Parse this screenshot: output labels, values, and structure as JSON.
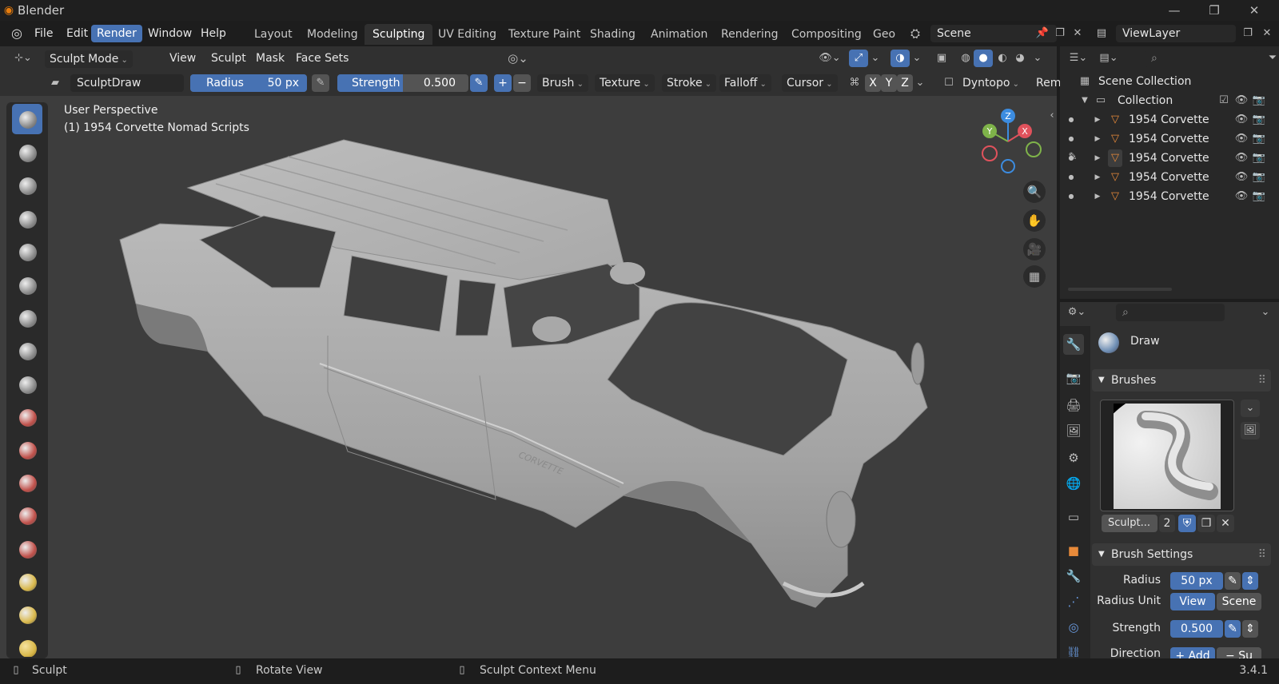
{
  "app": {
    "title": "Blender",
    "version": "3.4.1"
  },
  "menu": {
    "items": [
      "File",
      "Edit",
      "Render",
      "Window",
      "Help"
    ],
    "active": "Render"
  },
  "workspaces": {
    "tabs": [
      "Layout",
      "Modeling",
      "Sculpting",
      "UV Editing",
      "Texture Paint",
      "Shading",
      "Animation",
      "Rendering",
      "Compositing",
      "Geo"
    ],
    "active": "Sculpting"
  },
  "scene": {
    "name": "Scene",
    "view_layer": "ViewLayer"
  },
  "viewport_header": {
    "mode": "Sculpt Mode",
    "menus": [
      "View",
      "Sculpt",
      "Mask",
      "Face Sets"
    ]
  },
  "tool_header": {
    "brush_name": "SculptDraw",
    "radius_label": "Radius",
    "radius_value": "50 px",
    "strength_label": "Strength",
    "strength_value": "0.500",
    "strength_fraction": 0.5,
    "plus": "+",
    "minus": "−",
    "dropdowns": [
      "Brush",
      "Texture",
      "Stroke",
      "Falloff",
      "Cursor"
    ],
    "axes": [
      "X",
      "Y",
      "Z"
    ],
    "dyntopo": "Dyntopo",
    "remesh": "Rem"
  },
  "viewport": {
    "perspective": "User Perspective",
    "object": "(1) 1954 Corvette Nomad Scripts",
    "model_badge": "CORVETTE"
  },
  "gizmo": {
    "x": "X",
    "y": "Y",
    "z": "Z"
  },
  "outliner": {
    "root": "Scene Collection",
    "collection": "Collection",
    "objects": [
      "1954 Corvette",
      "1954 Corvette",
      "1954 Corvette",
      "1954 Corvette",
      "1954 Corvette"
    ]
  },
  "properties": {
    "brush_title": "Draw",
    "brushes_panel": "Brushes",
    "brush_slot": "Sculpt...",
    "brush_users": "2",
    "brush_settings_panel": "Brush Settings",
    "radius_label": "Radius",
    "radius_value": "50 px",
    "radius_unit_label": "Radius Unit",
    "radius_unit_options": [
      "View",
      "Scene"
    ],
    "radius_unit_active": "View",
    "strength_label": "Strength",
    "strength_value": "0.500",
    "direction_label": "Direction",
    "direction_add": "+ Add",
    "direction_sub": "− Su"
  },
  "status": {
    "left_click": "Sculpt",
    "middle_click": "Rotate View",
    "right_click": "Sculpt Context Menu"
  },
  "colors": {
    "accent": "#4772b3",
    "x_axis": "#e0525c",
    "y_axis": "#7fb34a",
    "z_axis": "#3c8ce0",
    "mesh_icon": "#e88a3a"
  }
}
